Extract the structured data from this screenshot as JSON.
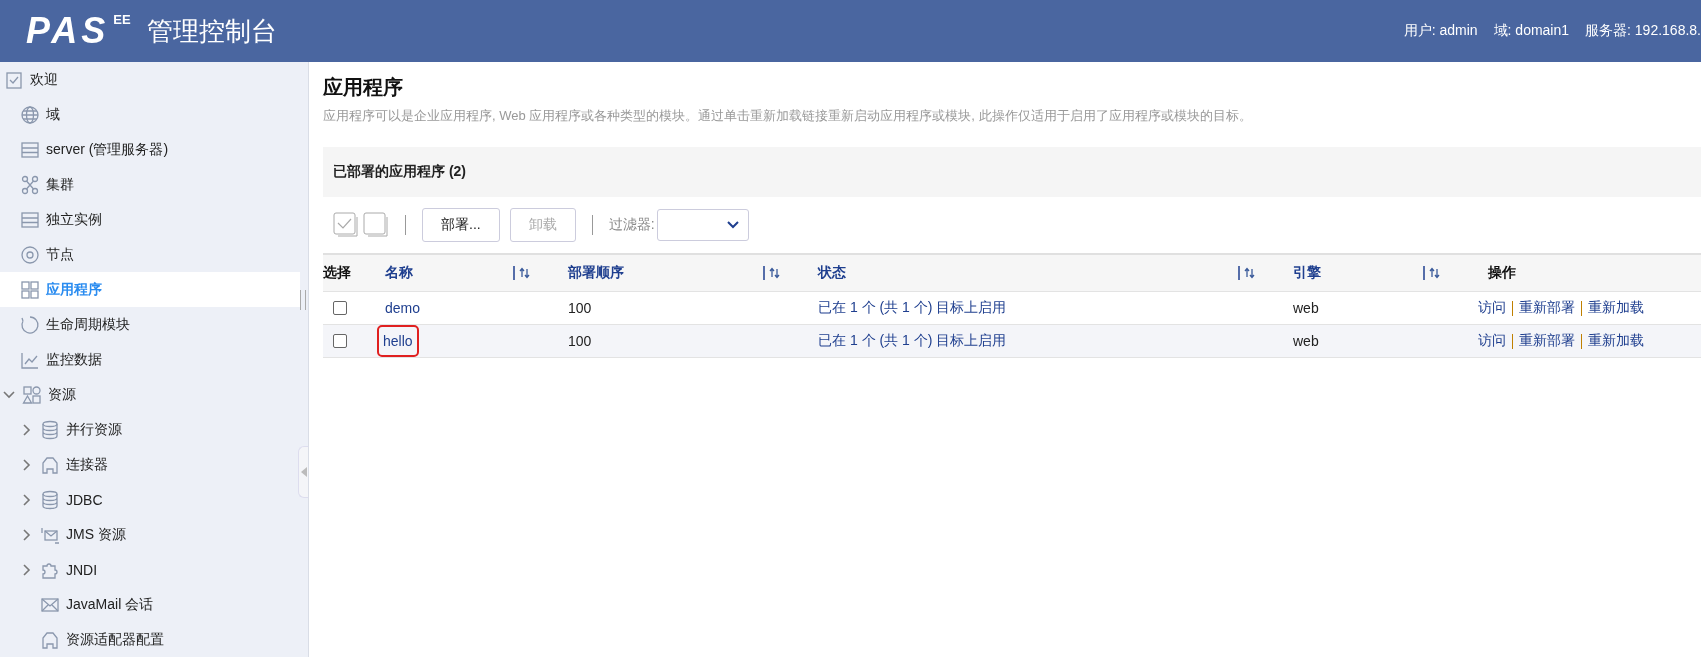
{
  "header": {
    "logo": "PAS",
    "logo_sup": "EE",
    "title": "管理控制台",
    "info": [
      "用户: admin",
      "域: domain1",
      "服务器: 192.168.8."
    ]
  },
  "sidebar": {
    "items": [
      {
        "label": "欢迎",
        "kind": "welcome",
        "selected": false
      },
      {
        "label": "域",
        "kind": "leaf",
        "selected": false
      },
      {
        "label": "server (管理服务器)",
        "kind": "leaf",
        "selected": false
      },
      {
        "label": "集群",
        "kind": "leaf",
        "selected": false
      },
      {
        "label": "独立实例",
        "kind": "leaf",
        "selected": false
      },
      {
        "label": "节点",
        "kind": "leaf",
        "selected": false
      },
      {
        "label": "应用程序",
        "kind": "leaf",
        "selected": true
      },
      {
        "label": "生命周期模块",
        "kind": "leaf",
        "selected": false
      },
      {
        "label": "监控数据",
        "kind": "leaf",
        "selected": false
      },
      {
        "label": "资源",
        "kind": "group",
        "selected": false,
        "expanded": true,
        "children": [
          {
            "label": "并行资源",
            "kind": "group",
            "selected": false,
            "expanded": false
          },
          {
            "label": "连接器",
            "kind": "group",
            "selected": false,
            "expanded": false
          },
          {
            "label": "JDBC",
            "kind": "group",
            "selected": false,
            "expanded": false
          },
          {
            "label": "JMS 资源",
            "kind": "group",
            "selected": false,
            "expanded": false
          },
          {
            "label": "JNDI",
            "kind": "group",
            "selected": false,
            "expanded": false
          },
          {
            "label": "JavaMail 会话",
            "kind": "leaf",
            "selected": false
          },
          {
            "label": "资源适配器配置",
            "kind": "leaf",
            "selected": false
          }
        ]
      }
    ]
  },
  "page": {
    "title": "应用程序",
    "description": "应用程序可以是企业应用程序, Web 应用程序或各种类型的模块。通过单击重新加载链接重新启动应用程序或模块, 此操作仅适用于启用了应用程序或模块的目标。"
  },
  "panel": {
    "title": "已部署的应用程序 (2)",
    "toolbar": {
      "buttons": [
        {
          "label": "部署...",
          "disabled": false
        },
        {
          "label": "卸载",
          "disabled": true
        }
      ],
      "filter_label": "过滤器:"
    },
    "table": {
      "columns": [
        {
          "label": "选择",
          "sortable": false
        },
        {
          "label": "名称",
          "sortable": true
        },
        {
          "label": "部署顺序",
          "sortable": true
        },
        {
          "label": "状态",
          "sortable": true
        },
        {
          "label": "引擎",
          "sortable": true
        },
        {
          "label": "操作",
          "sortable": false
        }
      ],
      "rows": [
        {
          "checked": false,
          "name": "demo",
          "highlighted": false,
          "order": "100",
          "status": "已在 1 个 (共 1 个) 目标上启用",
          "engine": "web",
          "actions": [
            "访问",
            "重新部署",
            "重新加载"
          ]
        },
        {
          "checked": false,
          "name": "hello",
          "highlighted": true,
          "order": "100",
          "status": "已在 1 个 (共 1 个) 目标上启用",
          "engine": "web",
          "actions": [
            "访问",
            "重新部署",
            "重新加载"
          ]
        }
      ]
    }
  }
}
